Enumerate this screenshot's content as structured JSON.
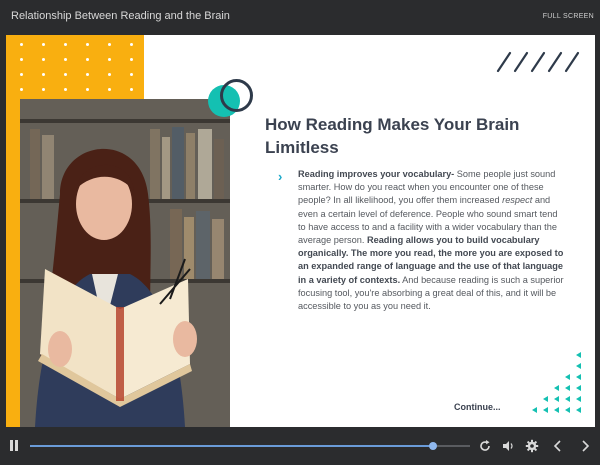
{
  "window": {
    "title": "Relationship Between Reading and the Brain",
    "full_screen_label": "FULL SCREEN"
  },
  "slide": {
    "heading": "How Reading Makes Your Brain Limitless",
    "body_segments": [
      {
        "text": "Reading improves your vocabulary-",
        "style": "bold"
      },
      {
        "text": " Some people just sound smarter. How do you react when you encounter one of these people? In all likelihood, you offer them increased ",
        "style": "normal"
      },
      {
        "text": "respect",
        "style": "italic"
      },
      {
        "text": " and even a certain level of deference. People who sound smart tend to have access to and a facility with a wider vocabulary than the average person. ",
        "style": "normal"
      },
      {
        "text": "Reading allows you to build vocabulary organically. The more you read, the more you are exposed to an expanded range of language and the use of that language in a variety of contexts.",
        "style": "bold"
      },
      {
        "text": " And because reading is such a superior focusing tool, you're absorbing a great deal of this, and it will be accessible to you as you need it.",
        "style": "normal"
      }
    ],
    "continue_label": "Continue...",
    "colors": {
      "yellow": "#f9af10",
      "teal": "#14c0b2",
      "navy": "#2e3a4a",
      "accent_blue": "#1ca9c9"
    }
  },
  "player": {
    "progress": 0.915,
    "icons": [
      "pause-icon",
      "replay-icon",
      "volume-icon",
      "settings-icon",
      "prev-icon",
      "next-icon"
    ]
  }
}
